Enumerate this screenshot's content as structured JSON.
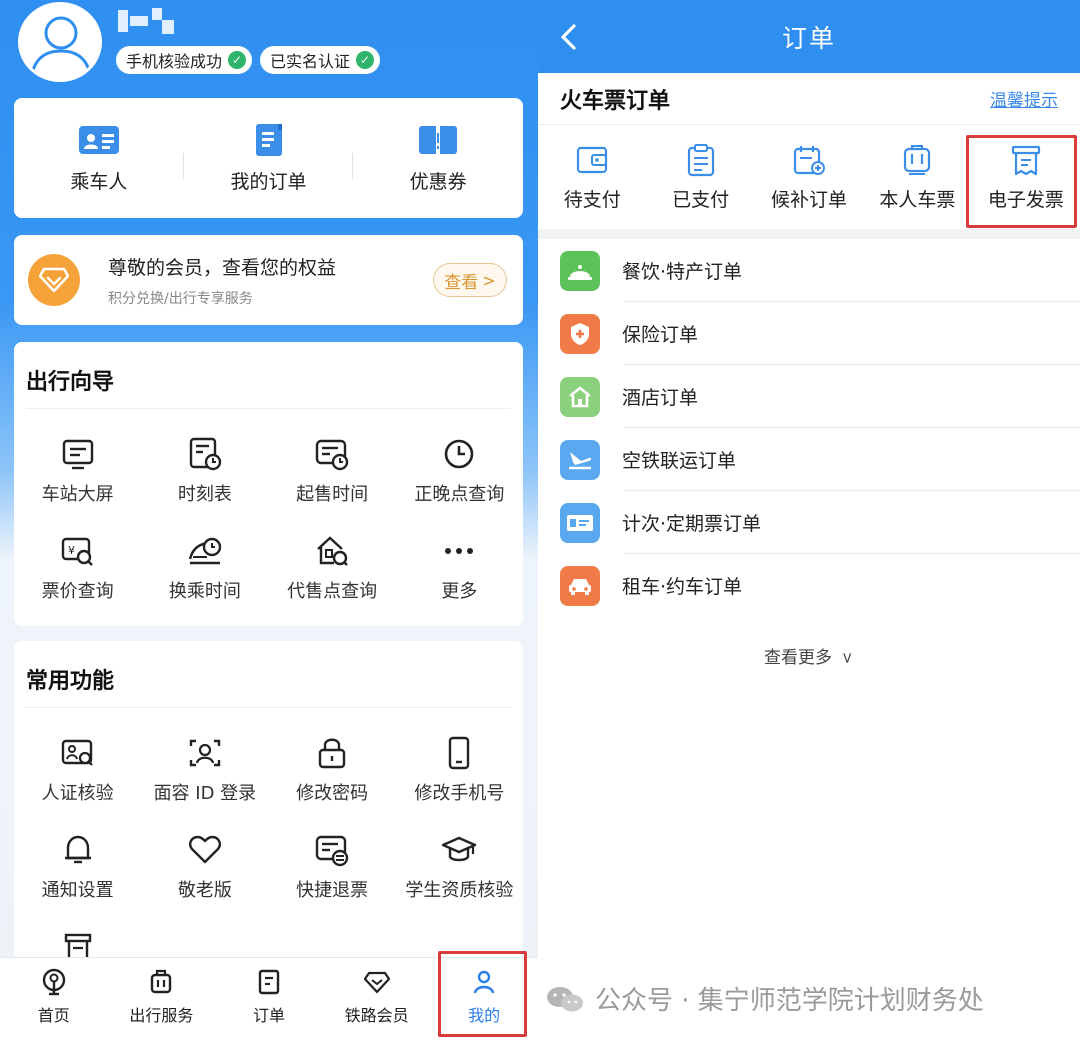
{
  "profile": {
    "badges": [
      "手机核验成功",
      "已实名认证"
    ]
  },
  "quick_actions": [
    {
      "label": "乘车人",
      "icon": "passenger-card-icon"
    },
    {
      "label": "我的订单",
      "icon": "order-doc-icon"
    },
    {
      "label": "优惠券",
      "icon": "coupon-icon"
    }
  ],
  "vip": {
    "title": "尊敬的会员，查看您的权益",
    "subtitle": "积分兑换/出行专享服务",
    "button": "查看"
  },
  "travel_guide": {
    "title": "出行向导",
    "items": [
      {
        "label": "车站大屏",
        "icon": "station-screen-icon"
      },
      {
        "label": "时刻表",
        "icon": "timetable-icon"
      },
      {
        "label": "起售时间",
        "icon": "sale-time-icon"
      },
      {
        "label": "正晚点查询",
        "icon": "clock-icon"
      },
      {
        "label": "票价查询",
        "icon": "fare-query-icon"
      },
      {
        "label": "换乘时间",
        "icon": "transfer-time-icon"
      },
      {
        "label": "代售点查询",
        "icon": "agency-query-icon"
      },
      {
        "label": "更多",
        "icon": "more-dots-icon"
      }
    ]
  },
  "common_functions": {
    "title": "常用功能",
    "items": [
      {
        "label": "人证核验",
        "icon": "id-verify-icon"
      },
      {
        "label": "面容 ID 登录",
        "icon": "face-id-icon"
      },
      {
        "label": "修改密码",
        "icon": "lock-icon"
      },
      {
        "label": "修改手机号",
        "icon": "phone-icon"
      },
      {
        "label": "通知设置",
        "icon": "bell-icon"
      },
      {
        "label": "敬老版",
        "icon": "heart-icon"
      },
      {
        "label": "快捷退票",
        "icon": "refund-ticket-icon"
      },
      {
        "label": "学生资质核验",
        "icon": "graduation-cap-icon"
      }
    ]
  },
  "tabbar": [
    {
      "label": "首页",
      "icon": "railway-logo-icon",
      "active": false
    },
    {
      "label": "出行服务",
      "icon": "luggage-icon",
      "active": false
    },
    {
      "label": "订单",
      "icon": "order-icon",
      "active": false
    },
    {
      "label": "铁路会员",
      "icon": "diamond-icon",
      "active": false
    },
    {
      "label": "我的",
      "icon": "person-icon",
      "active": true
    }
  ],
  "orders_page": {
    "title": "订单",
    "section_title": "火车票订单",
    "tip_link": "温馨提示",
    "order_types": [
      {
        "label": "待支付",
        "icon": "wallet-icon"
      },
      {
        "label": "已支付",
        "icon": "clipboard-icon"
      },
      {
        "label": "候补订单",
        "icon": "calendar-add-icon"
      },
      {
        "label": "本人车票",
        "icon": "train-icon"
      },
      {
        "label": "电子发票",
        "icon": "invoice-icon"
      }
    ],
    "other_orders": [
      {
        "label": "餐饮·特产订单",
        "icon": "dining-bell-icon",
        "color": "#5cc25a"
      },
      {
        "label": "保险订单",
        "icon": "shield-plus-icon",
        "color": "#f07a48"
      },
      {
        "label": "酒店订单",
        "icon": "hotel-icon",
        "color": "#8bd17d"
      },
      {
        "label": "空铁联运订单",
        "icon": "plane-train-icon",
        "color": "#5aa8f0"
      },
      {
        "label": "计次·定期票订单",
        "icon": "pass-ticket-icon",
        "color": "#5aa8f0"
      },
      {
        "label": "租车·约车订单",
        "icon": "car-icon",
        "color": "#f07a48"
      }
    ],
    "see_more": "查看更多"
  },
  "watermark": "公众号 · 集宁师范学院计划财务处",
  "colors": {
    "primary_blue": "#2f8ff0",
    "highlight_red": "#d83b3b",
    "vip_gold": "#f5a238"
  }
}
